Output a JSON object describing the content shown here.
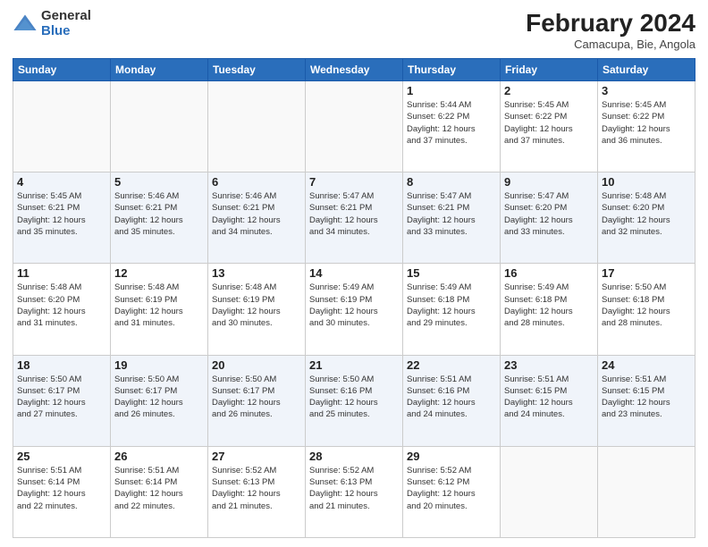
{
  "header": {
    "logo_general": "General",
    "logo_blue": "Blue",
    "month_year": "February 2024",
    "location": "Camacupa, Bie, Angola"
  },
  "days_of_week": [
    "Sunday",
    "Monday",
    "Tuesday",
    "Wednesday",
    "Thursday",
    "Friday",
    "Saturday"
  ],
  "weeks": [
    [
      {
        "day": "",
        "info": ""
      },
      {
        "day": "",
        "info": ""
      },
      {
        "day": "",
        "info": ""
      },
      {
        "day": "",
        "info": ""
      },
      {
        "day": "1",
        "info": "Sunrise: 5:44 AM\nSunset: 6:22 PM\nDaylight: 12 hours\nand 37 minutes."
      },
      {
        "day": "2",
        "info": "Sunrise: 5:45 AM\nSunset: 6:22 PM\nDaylight: 12 hours\nand 37 minutes."
      },
      {
        "day": "3",
        "info": "Sunrise: 5:45 AM\nSunset: 6:22 PM\nDaylight: 12 hours\nand 36 minutes."
      }
    ],
    [
      {
        "day": "4",
        "info": "Sunrise: 5:45 AM\nSunset: 6:21 PM\nDaylight: 12 hours\nand 35 minutes."
      },
      {
        "day": "5",
        "info": "Sunrise: 5:46 AM\nSunset: 6:21 PM\nDaylight: 12 hours\nand 35 minutes."
      },
      {
        "day": "6",
        "info": "Sunrise: 5:46 AM\nSunset: 6:21 PM\nDaylight: 12 hours\nand 34 minutes."
      },
      {
        "day": "7",
        "info": "Sunrise: 5:47 AM\nSunset: 6:21 PM\nDaylight: 12 hours\nand 34 minutes."
      },
      {
        "day": "8",
        "info": "Sunrise: 5:47 AM\nSunset: 6:21 PM\nDaylight: 12 hours\nand 33 minutes."
      },
      {
        "day": "9",
        "info": "Sunrise: 5:47 AM\nSunset: 6:20 PM\nDaylight: 12 hours\nand 33 minutes."
      },
      {
        "day": "10",
        "info": "Sunrise: 5:48 AM\nSunset: 6:20 PM\nDaylight: 12 hours\nand 32 minutes."
      }
    ],
    [
      {
        "day": "11",
        "info": "Sunrise: 5:48 AM\nSunset: 6:20 PM\nDaylight: 12 hours\nand 31 minutes."
      },
      {
        "day": "12",
        "info": "Sunrise: 5:48 AM\nSunset: 6:19 PM\nDaylight: 12 hours\nand 31 minutes."
      },
      {
        "day": "13",
        "info": "Sunrise: 5:48 AM\nSunset: 6:19 PM\nDaylight: 12 hours\nand 30 minutes."
      },
      {
        "day": "14",
        "info": "Sunrise: 5:49 AM\nSunset: 6:19 PM\nDaylight: 12 hours\nand 30 minutes."
      },
      {
        "day": "15",
        "info": "Sunrise: 5:49 AM\nSunset: 6:18 PM\nDaylight: 12 hours\nand 29 minutes."
      },
      {
        "day": "16",
        "info": "Sunrise: 5:49 AM\nSunset: 6:18 PM\nDaylight: 12 hours\nand 28 minutes."
      },
      {
        "day": "17",
        "info": "Sunrise: 5:50 AM\nSunset: 6:18 PM\nDaylight: 12 hours\nand 28 minutes."
      }
    ],
    [
      {
        "day": "18",
        "info": "Sunrise: 5:50 AM\nSunset: 6:17 PM\nDaylight: 12 hours\nand 27 minutes."
      },
      {
        "day": "19",
        "info": "Sunrise: 5:50 AM\nSunset: 6:17 PM\nDaylight: 12 hours\nand 26 minutes."
      },
      {
        "day": "20",
        "info": "Sunrise: 5:50 AM\nSunset: 6:17 PM\nDaylight: 12 hours\nand 26 minutes."
      },
      {
        "day": "21",
        "info": "Sunrise: 5:50 AM\nSunset: 6:16 PM\nDaylight: 12 hours\nand 25 minutes."
      },
      {
        "day": "22",
        "info": "Sunrise: 5:51 AM\nSunset: 6:16 PM\nDaylight: 12 hours\nand 24 minutes."
      },
      {
        "day": "23",
        "info": "Sunrise: 5:51 AM\nSunset: 6:15 PM\nDaylight: 12 hours\nand 24 minutes."
      },
      {
        "day": "24",
        "info": "Sunrise: 5:51 AM\nSunset: 6:15 PM\nDaylight: 12 hours\nand 23 minutes."
      }
    ],
    [
      {
        "day": "25",
        "info": "Sunrise: 5:51 AM\nSunset: 6:14 PM\nDaylight: 12 hours\nand 22 minutes."
      },
      {
        "day": "26",
        "info": "Sunrise: 5:51 AM\nSunset: 6:14 PM\nDaylight: 12 hours\nand 22 minutes."
      },
      {
        "day": "27",
        "info": "Sunrise: 5:52 AM\nSunset: 6:13 PM\nDaylight: 12 hours\nand 21 minutes."
      },
      {
        "day": "28",
        "info": "Sunrise: 5:52 AM\nSunset: 6:13 PM\nDaylight: 12 hours\nand 21 minutes."
      },
      {
        "day": "29",
        "info": "Sunrise: 5:52 AM\nSunset: 6:12 PM\nDaylight: 12 hours\nand 20 minutes."
      },
      {
        "day": "",
        "info": ""
      },
      {
        "day": "",
        "info": ""
      }
    ]
  ]
}
